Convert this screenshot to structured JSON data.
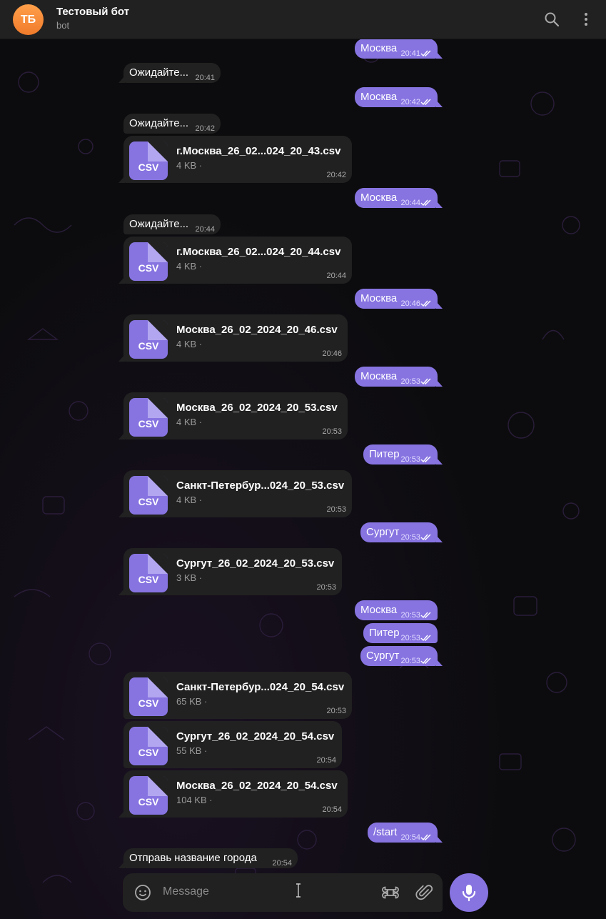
{
  "header": {
    "avatar_initials": "ТБ",
    "title": "Тестовый бот",
    "subtitle": "bot",
    "icons": [
      "search-icon",
      "more-vertical-icon"
    ]
  },
  "messages": [
    {
      "kind": "out",
      "text": "Москва",
      "time": "20:41"
    },
    {
      "kind": "in",
      "text": "Ожидайте...",
      "time": "20:41"
    },
    {
      "kind": "out",
      "text": "Москва",
      "time": "20:42"
    },
    {
      "kind": "in",
      "text": "Ожидайте...",
      "time": "20:42"
    },
    {
      "kind": "file",
      "ext": "CSV",
      "name": "г.Москва_26_02...024_20_43.csv",
      "size": "4 KB ·",
      "time": "20:42"
    },
    {
      "kind": "out",
      "text": "Москва",
      "time": "20:44"
    },
    {
      "kind": "in",
      "text": "Ожидайте...",
      "time": "20:44"
    },
    {
      "kind": "file",
      "ext": "CSV",
      "name": "г.Москва_26_02...024_20_44.csv",
      "size": "4 KB ·",
      "time": "20:44"
    },
    {
      "kind": "out",
      "text": "Москва",
      "time": "20:46"
    },
    {
      "kind": "file",
      "ext": "CSV",
      "name": "Москва_26_02_2024_20_46.csv",
      "size": "4 KB ·",
      "time": "20:46"
    },
    {
      "kind": "out",
      "text": "Москва",
      "time": "20:53"
    },
    {
      "kind": "file",
      "ext": "CSV",
      "name": "Москва_26_02_2024_20_53.csv",
      "size": "4 KB ·",
      "time": "20:53"
    },
    {
      "kind": "out",
      "text": "Питер",
      "time": "20:53"
    },
    {
      "kind": "file",
      "ext": "CSV",
      "name": "Санкт-Петербур...024_20_53.csv",
      "size": "4 KB ·",
      "time": "20:53"
    },
    {
      "kind": "out",
      "text": "Сургут",
      "time": "20:53"
    },
    {
      "kind": "file",
      "ext": "CSV",
      "name": "Сургут_26_02_2024_20_53.csv",
      "size": "3 KB ·",
      "time": "20:53"
    },
    {
      "kind": "out",
      "text": "Москва",
      "time": "20:53"
    },
    {
      "kind": "out",
      "text": "Питер",
      "time": "20:53"
    },
    {
      "kind": "out",
      "text": "Сургут",
      "time": "20:53"
    },
    {
      "kind": "file",
      "ext": "CSV",
      "name": "Санкт-Петербур...024_20_54.csv",
      "size": "65 KB ·",
      "time": "20:53"
    },
    {
      "kind": "file",
      "ext": "CSV",
      "name": "Сургут_26_02_2024_20_54.csv",
      "size": "55 KB ·",
      "time": "20:54"
    },
    {
      "kind": "file",
      "ext": "CSV",
      "name": "Москва_26_02_2024_20_54.csv",
      "size": "104 KB ·",
      "time": "20:54"
    },
    {
      "kind": "out",
      "text": "/start",
      "time": "20:54"
    },
    {
      "kind": "in",
      "text": "Отправь название города",
      "time": "20:54"
    }
  ],
  "composer": {
    "placeholder": "Message",
    "icons": [
      "emoji-icon",
      "command-icon",
      "attach-icon",
      "microphone-icon"
    ]
  },
  "colors": {
    "accent": "#8774e1",
    "header_bg": "#212121",
    "incoming_bg": "#212121",
    "avatar": "#f58a34"
  }
}
